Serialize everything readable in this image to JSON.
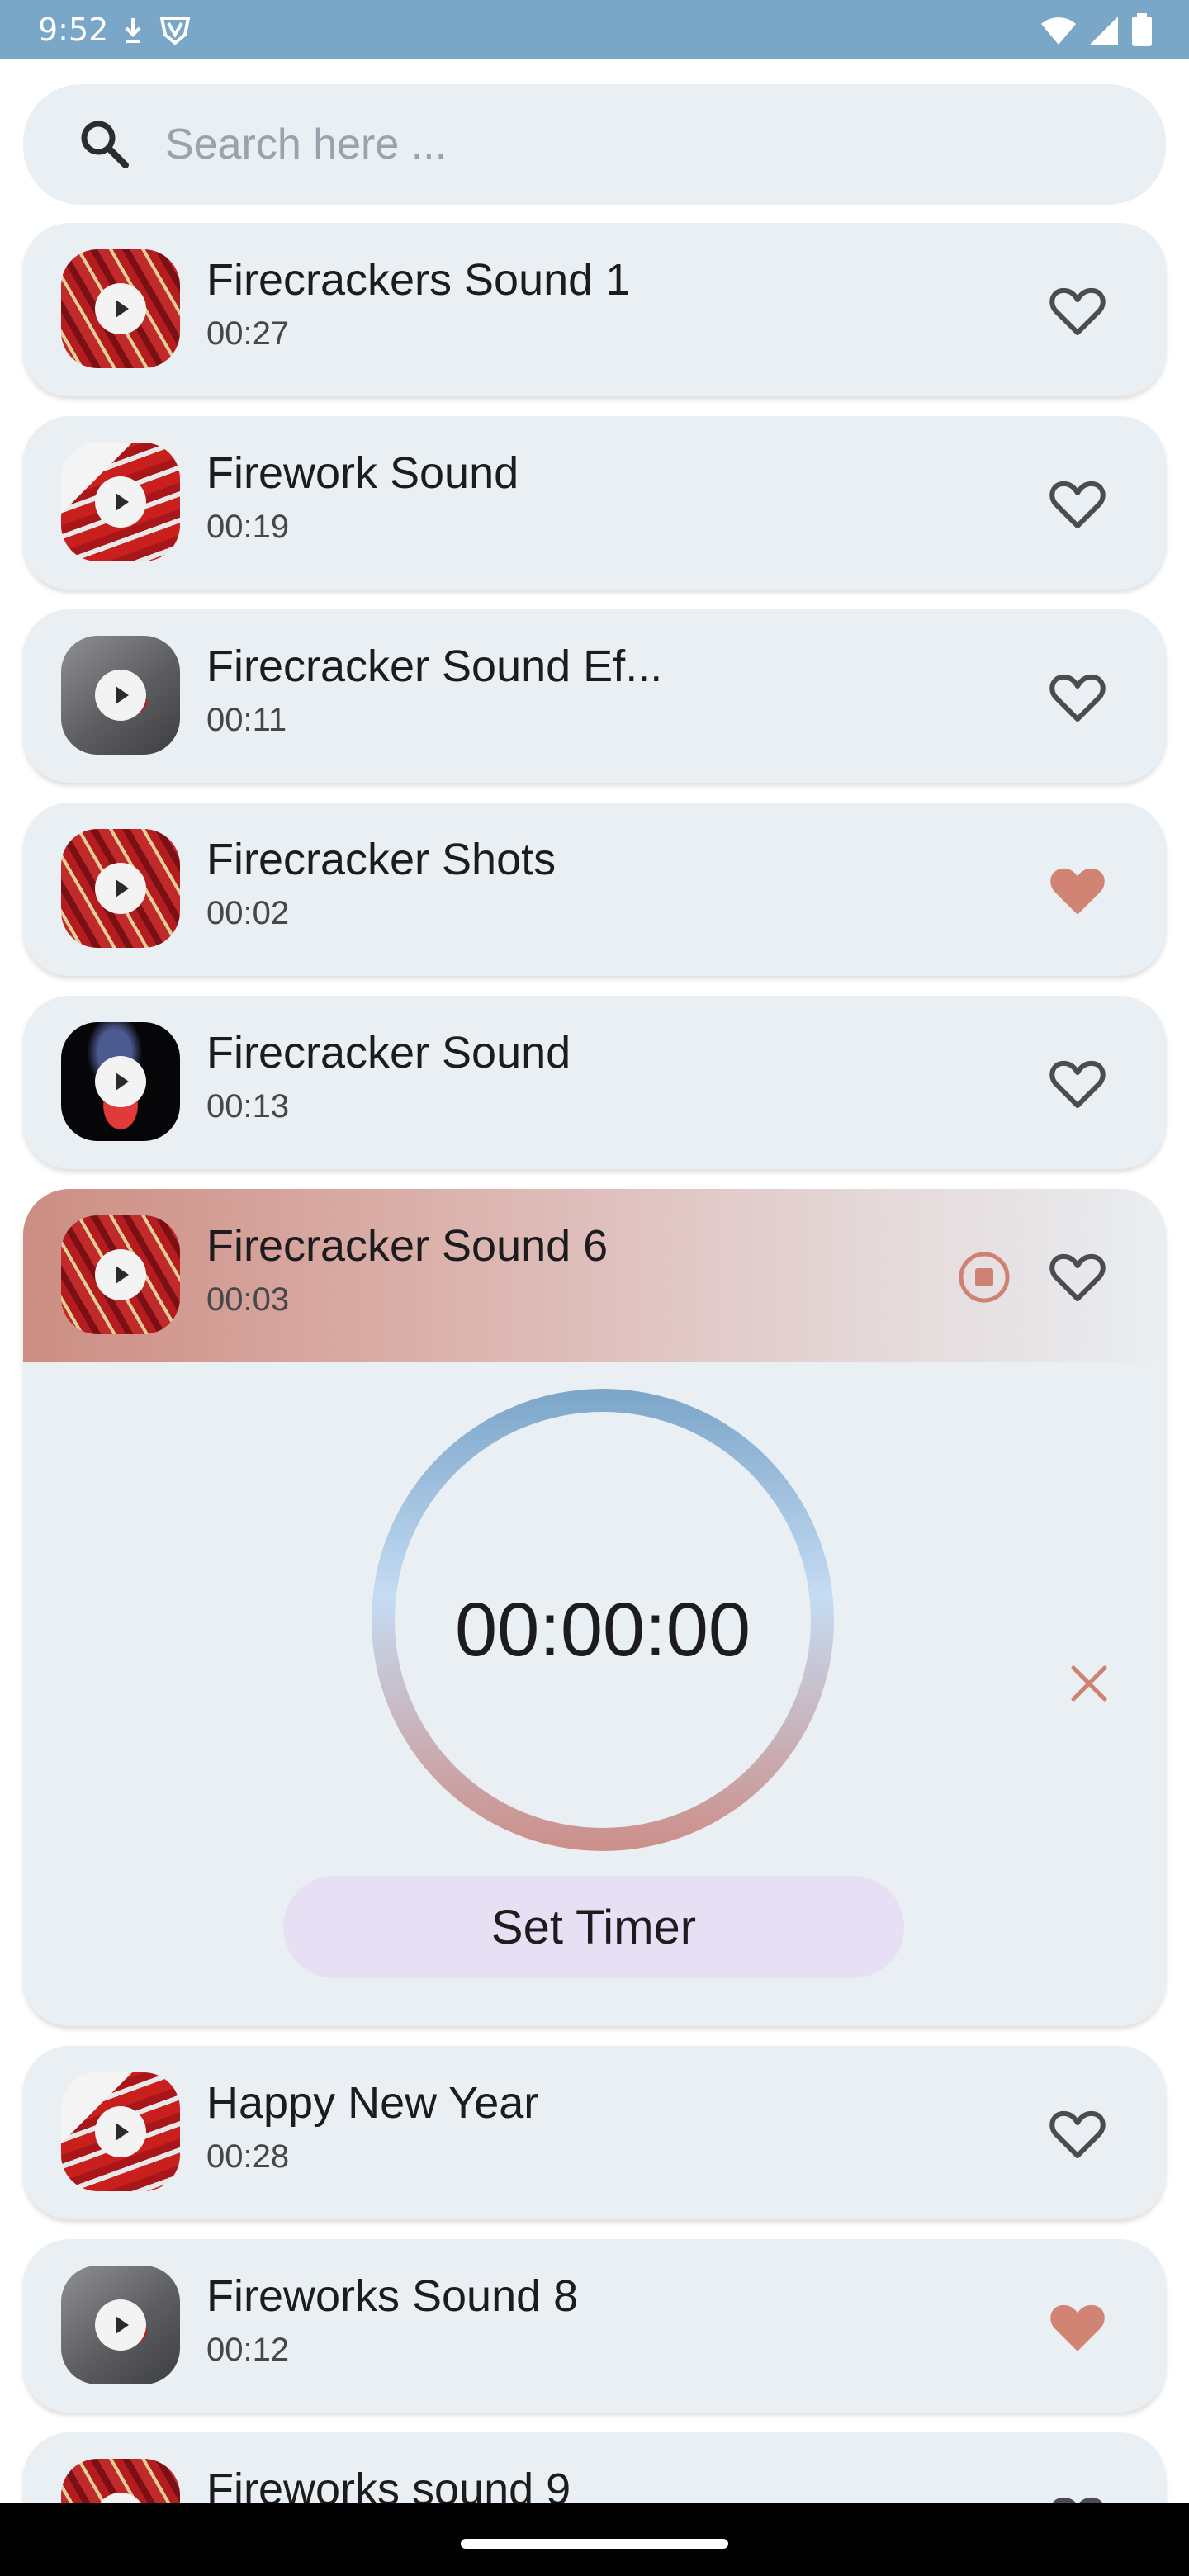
{
  "status_bar": {
    "time": "9:52"
  },
  "search": {
    "placeholder": "Search here ..."
  },
  "sounds": [
    {
      "title": "Firecrackers Sound 1",
      "duration": "00:27",
      "favorite": false
    },
    {
      "title": "Firework Sound",
      "duration": "00:19",
      "favorite": false
    },
    {
      "title": "Firecracker Sound Ef...",
      "duration": "00:11",
      "favorite": false
    },
    {
      "title": "Firecracker Shots",
      "duration": "00:02",
      "favorite": true
    },
    {
      "title": "Firecracker Sound",
      "duration": "00:13",
      "favorite": false
    },
    {
      "title": "Firecracker Sound 6",
      "duration": "00:03",
      "favorite": false,
      "expanded": true,
      "playing": true
    },
    {
      "title": "Happy New Year",
      "duration": "00:28",
      "favorite": false
    },
    {
      "title": "Fireworks Sound 8",
      "duration": "00:12",
      "favorite": true
    },
    {
      "title": "Fireworks sound 9",
      "duration": "",
      "favorite": false
    }
  ],
  "timer": {
    "display": "00:00:00",
    "set_label": "Set Timer"
  },
  "colors": {
    "status_bar": "#7aa7c7",
    "card_background": "#e9eff3",
    "favorite_heart": "#d18474",
    "outline_heart": "#4a4c50",
    "set_timer_button": "#e7dff4",
    "accent_stop": "#cf8273"
  },
  "icons": {
    "search": "search-icon",
    "favorite_filled": "heart-filled-icon",
    "favorite_outline": "heart-outline-icon",
    "play": "play-icon",
    "stop": "stop-icon",
    "close": "close-icon"
  }
}
